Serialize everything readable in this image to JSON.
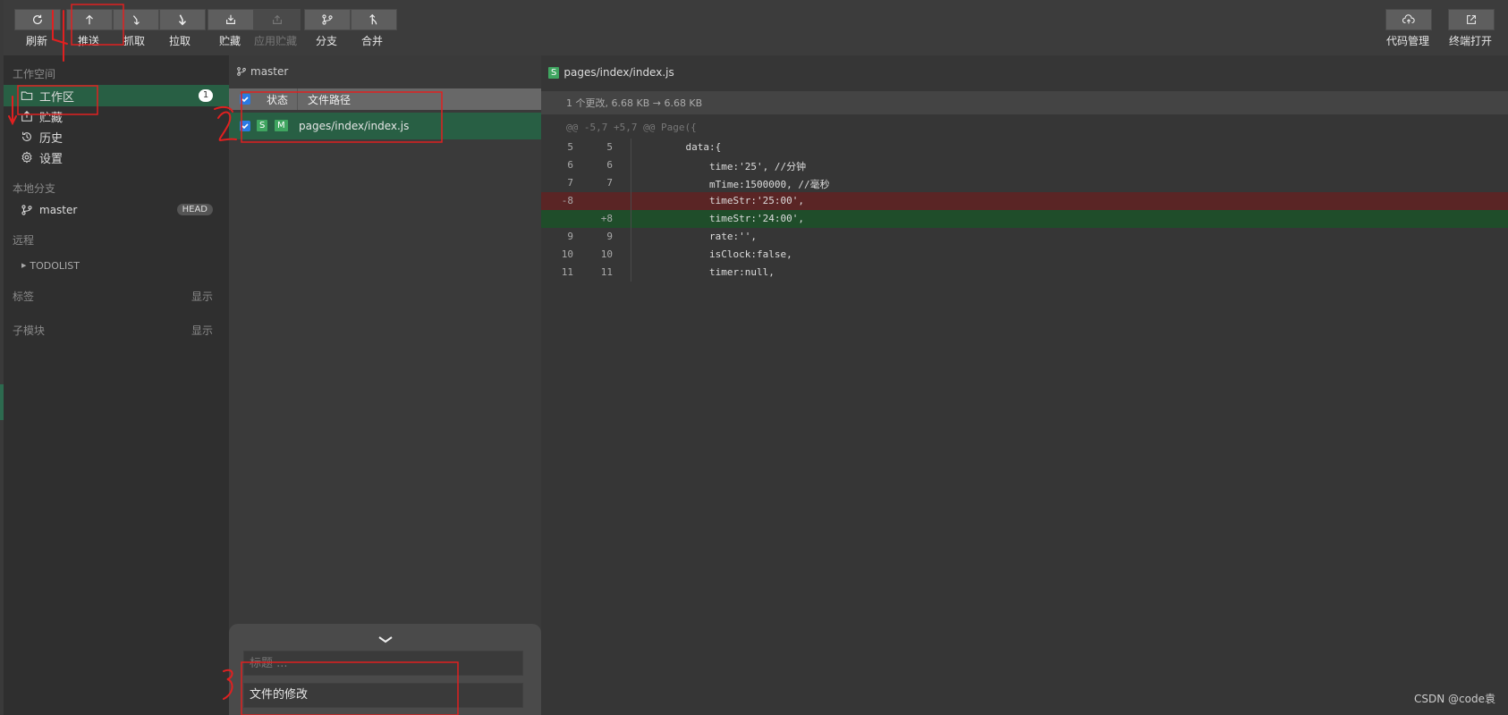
{
  "toolbar": {
    "left_buttons": [
      {
        "label": "刷新",
        "icon": "refresh-icon"
      },
      {
        "label": "推送",
        "icon": "push-icon"
      },
      {
        "label": "抓取",
        "icon": "fetch-icon"
      },
      {
        "label": "拉取",
        "icon": "pull-icon"
      },
      {
        "label": "贮藏",
        "icon": "stash-icon"
      },
      {
        "label": "应用贮藏",
        "icon": "apply-stash-icon",
        "disabled": true
      },
      {
        "label": "分支",
        "icon": "branch-icon"
      },
      {
        "label": "合并",
        "icon": "merge-icon"
      }
    ],
    "right_buttons": [
      {
        "label": "代码管理",
        "icon": "cloud-upload-icon"
      },
      {
        "label": "终端打开",
        "icon": "external-link-icon"
      }
    ]
  },
  "sidebar": {
    "workspace_title": "工作空间",
    "items": [
      {
        "label": "工作区",
        "badge": "1",
        "active": true
      },
      {
        "label": "贮藏"
      },
      {
        "label": "历史"
      },
      {
        "label": "设置"
      }
    ],
    "local_branches_title": "本地分支",
    "branch": {
      "name": "master",
      "head": "HEAD"
    },
    "remote_title": "远程",
    "remote": "TODOLIST",
    "tags_title": "标签",
    "tags_show": "显示",
    "submodules_title": "子模块",
    "submodules_show": "显示"
  },
  "middle": {
    "branch": "master",
    "columns": {
      "status": "状态",
      "path": "文件路径"
    },
    "files": [
      {
        "tag1": "S",
        "tag2": "M",
        "path": "pages/index/index.js",
        "checked": true
      }
    ],
    "commit": {
      "title_placeholder": "标题 ...",
      "message": "文件的修改"
    }
  },
  "diff": {
    "file_tag": "S",
    "file": "pages/index/index.js",
    "summary": "1 个更改, 6.68 KB → 6.68 KB",
    "hunk": "@@ -5,7 +5,7 @@ Page({",
    "lines": [
      {
        "old": "5",
        "new": "5",
        "code": "    data:{",
        "type": "ctx"
      },
      {
        "old": "6",
        "new": "6",
        "code": "        time:'25', //分钟",
        "type": "ctx"
      },
      {
        "old": "7",
        "new": "7",
        "code": "        mTime:1500000, //毫秒",
        "type": "ctx"
      },
      {
        "old": "-8",
        "new": "",
        "code": "        timeStr:'25:00',",
        "type": "del"
      },
      {
        "old": "",
        "new": "+8",
        "code": "        timeStr:'24:00',",
        "type": "add"
      },
      {
        "old": "9",
        "new": "9",
        "code": "        rate:'',",
        "type": "ctx"
      },
      {
        "old": "10",
        "new": "10",
        "code": "        isClock:false,",
        "type": "ctx"
      },
      {
        "old": "11",
        "new": "11",
        "code": "        timer:null,",
        "type": "ctx"
      }
    ]
  },
  "watermark": "CSDN @code袁",
  "annotations": {
    "marks": [
      "4",
      "2",
      "3"
    ],
    "color": "#e02020"
  }
}
